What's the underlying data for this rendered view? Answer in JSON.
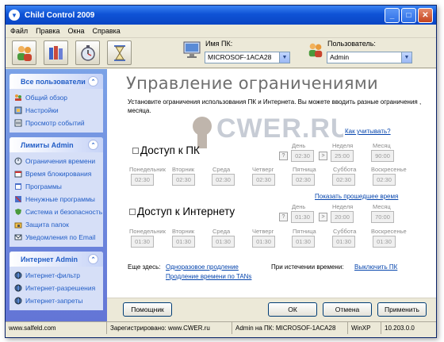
{
  "window": {
    "title": "Child Control 2009"
  },
  "menu": [
    "Файл",
    "Правка",
    "Окна",
    "Справка"
  ],
  "toolbar": {
    "pc_label": "Имя ПК:",
    "pc_value": "MICROSOF-1ACA28",
    "user_label": "Пользователь:",
    "user_value": "Admin"
  },
  "sidebar": {
    "groups": [
      {
        "title": "Все пользователи",
        "items": [
          "Общий обзор",
          "Настройки",
          "Просмотр событий"
        ]
      },
      {
        "title": "Лимиты Admin",
        "items": [
          "Ограничения времени",
          "Время блокирования",
          "Программы",
          "Ненужные программы",
          "Система и безопасность",
          "Защита папок",
          "Уведомления по Email"
        ]
      },
      {
        "title": "Интернет Admin",
        "items": [
          "Интернет-фильтр",
          "Интернет-разрешения",
          "Интернет-запреты"
        ]
      }
    ]
  },
  "main": {
    "title": "Управление ограничениями",
    "description": "Установите ограничения использования ПК и Интернета. Вы можете вводить разные ограничения , месяца.",
    "how_to_count": "Как учитывать?",
    "watermark": "CWER.RU",
    "pc": {
      "title": "Доступ к ПК",
      "col_labels": [
        "День",
        "Неделя",
        "Месяц"
      ],
      "col_values": [
        "02:30",
        "25:00",
        "90:00"
      ],
      "help": "?",
      "more": ">",
      "day_labels": [
        "Понедельник",
        "Вторник",
        "Среда",
        "Четверг",
        "Пятница",
        "Суббота",
        "Воскресенье"
      ],
      "day_values": [
        "02:30",
        "02:30",
        "02:30",
        "02:30",
        "02:30",
        "02:30",
        "02:30"
      ]
    },
    "show_past": "Показать прошедшее время",
    "internet": {
      "title": "Доступ к Интернету",
      "col_labels": [
        "День",
        "Неделя",
        "Месяц"
      ],
      "col_values": [
        "01:30",
        "20:00",
        "70:00"
      ],
      "help": "?",
      "more": ">",
      "day_labels": [
        "Понедельник",
        "Вторник",
        "Среда",
        "Четверг",
        "Пятница",
        "Суббота",
        "Воскресенье"
      ],
      "day_values": [
        "01:30",
        "01:30",
        "01:30",
        "01:30",
        "01:30",
        "01:30",
        "01:30"
      ]
    },
    "also_here": "Еще здесь:",
    "one_time_extension": "Одноразовое продление",
    "tan_extension": "Продление времени по TANs",
    "on_expire": "При истечении времени:",
    "shutdown": "Выключить ПК"
  },
  "buttons": {
    "helper": "Помощник",
    "ok": "ОК",
    "cancel": "Отмена",
    "apply": "Применить"
  },
  "status": {
    "site": "www.salfeld.com",
    "registered": "Зарегистрировано: www.CWER.ru",
    "admin_on": "Admin на ПК: MICROSOF-1ACA28",
    "os": "WinXP",
    "version": "10.203.0.0"
  }
}
